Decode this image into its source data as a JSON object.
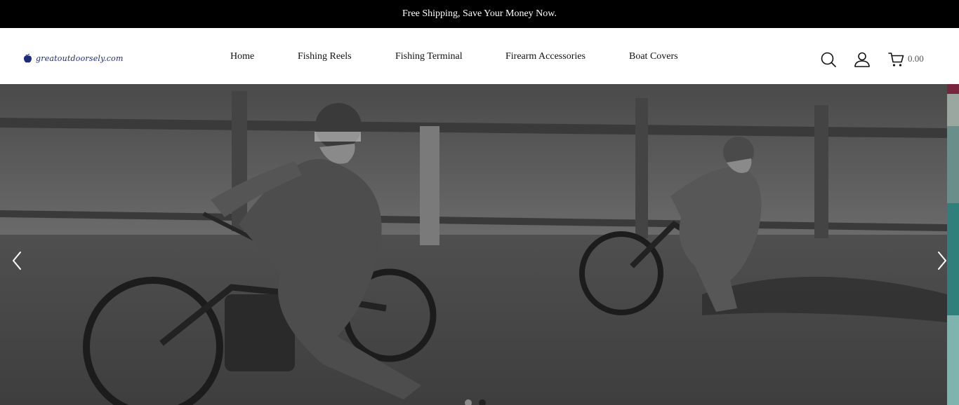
{
  "announcement": {
    "text": "Free Shipping, Save Your Money Now."
  },
  "brand": {
    "logo_text": "greatoutdoorsely.com",
    "logo_icon": "apple-icon",
    "color": "#1d2a7a"
  },
  "nav": {
    "items": [
      {
        "label": "Home"
      },
      {
        "label": "Fishing Reels"
      },
      {
        "label": "Fishing Terminal"
      },
      {
        "label": "Firearm Accessories"
      },
      {
        "label": "Boat Covers"
      }
    ]
  },
  "header_icons": {
    "search": "search-icon",
    "account": "user-icon",
    "cart": "cart-icon"
  },
  "cart": {
    "total": "0.00"
  },
  "hero": {
    "image": "black-and-white photo of two speedway motorcycle riders leaning into a dirt-track turn",
    "prev_icon": "chevron-left-icon",
    "next_icon": "chevron-right-icon",
    "slide_count": 2,
    "active_slide": 2
  },
  "colors": {
    "announcement_bg": "#000000",
    "announcement_text": "#ffffff",
    "text": "#111111"
  }
}
